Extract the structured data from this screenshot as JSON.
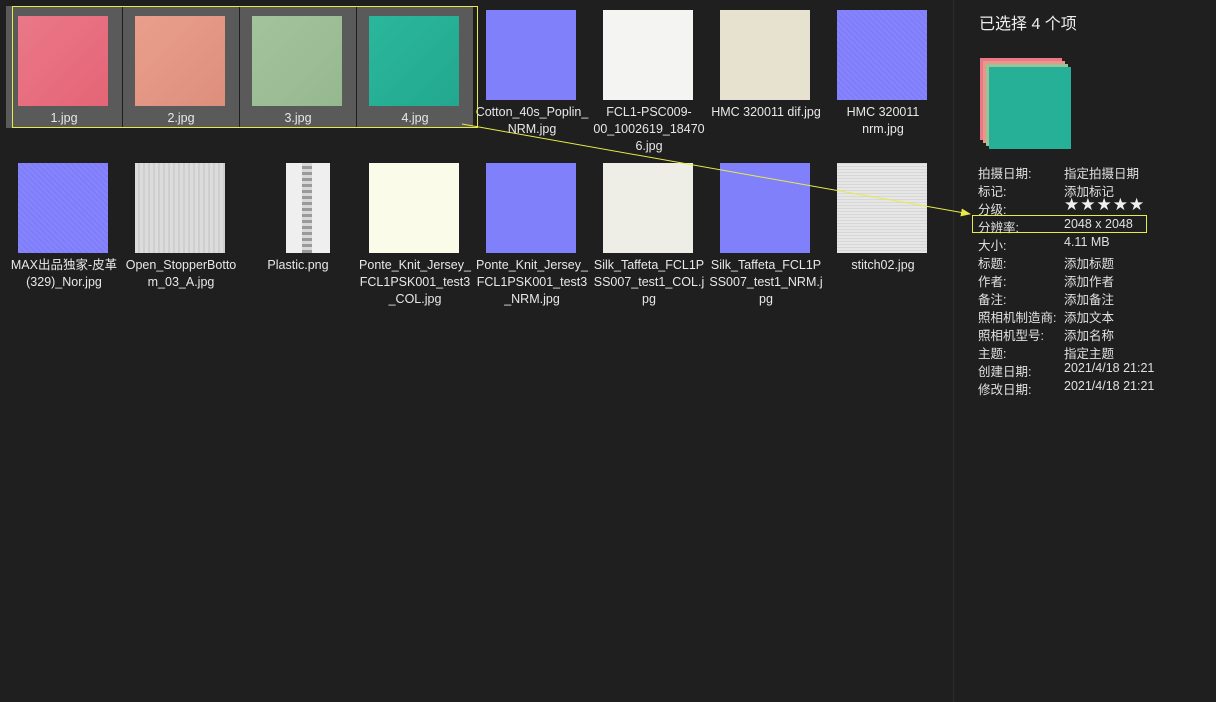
{
  "files": [
    {
      "name": "1.jpg",
      "swatch": "pink",
      "selected": true
    },
    {
      "name": "2.jpg",
      "swatch": "salmon",
      "selected": true
    },
    {
      "name": "3.jpg",
      "swatch": "sage",
      "selected": true
    },
    {
      "name": "4.jpg",
      "swatch": "teal",
      "selected": true
    },
    {
      "name": "Cotton_40s_Poplin_NRM.jpg",
      "swatch": "nrm"
    },
    {
      "name": "FCL1-PSC009-00_1002619_184706.jpg",
      "swatch": "white"
    },
    {
      "name": "HMC 320011 dif.jpg",
      "swatch": "cream"
    },
    {
      "name": "HMC 320011 nrm.jpg",
      "swatch": "nrm2"
    },
    {
      "name": "MAX出品独家-皮革(329)_Nor.jpg",
      "swatch": "nrm2"
    },
    {
      "name": "Open_StopperBottom_03_A.jpg",
      "swatch": "gray"
    },
    {
      "name": "Plastic.png",
      "swatch": "zip"
    },
    {
      "name": "Ponte_Knit_Jersey_FCL1PSK001_test3_COL.jpg",
      "swatch": "ivory"
    },
    {
      "name": "Ponte_Knit_Jersey_FCL1PSK001_test3_NRM.jpg",
      "swatch": "nrm"
    },
    {
      "name": "Silk_Taffeta_FCL1PSS007_test1_COL.jpg",
      "swatch": "silk"
    },
    {
      "name": "Silk_Taffeta_FCL1PSS007_test1_NRM.jpg",
      "swatch": "nrm"
    },
    {
      "name": "stitch02.jpg",
      "swatch": "linen"
    }
  ],
  "panel": {
    "title": "已选择 4 个项",
    "stars": "★★★★★",
    "props": [
      {
        "k": "拍摄日期:",
        "v": "指定拍摄日期"
      },
      {
        "k": "标记:",
        "v": "添加标记"
      },
      {
        "k": "分级:",
        "v": ""
      },
      {
        "k": "分辨率:",
        "v": "2048 x 2048"
      },
      {
        "k": "大小:",
        "v": "4.11 MB"
      },
      {
        "k": "标题:",
        "v": "添加标题"
      },
      {
        "k": "作者:",
        "v": "添加作者"
      },
      {
        "k": "备注:",
        "v": "添加备注"
      },
      {
        "k": "照相机制造商:",
        "v": "添加文本"
      },
      {
        "k": "照相机型号:",
        "v": "添加名称"
      },
      {
        "k": "主题:",
        "v": "指定主题"
      },
      {
        "k": "创建日期:",
        "v": "2021/4/18 21:21"
      },
      {
        "k": "修改日期:",
        "v": "2021/4/18 21:21"
      }
    ]
  },
  "colors": {
    "highlight": "#e9e94a",
    "selected_tile": "#5a5a5a",
    "background": "#1f1f1f"
  }
}
